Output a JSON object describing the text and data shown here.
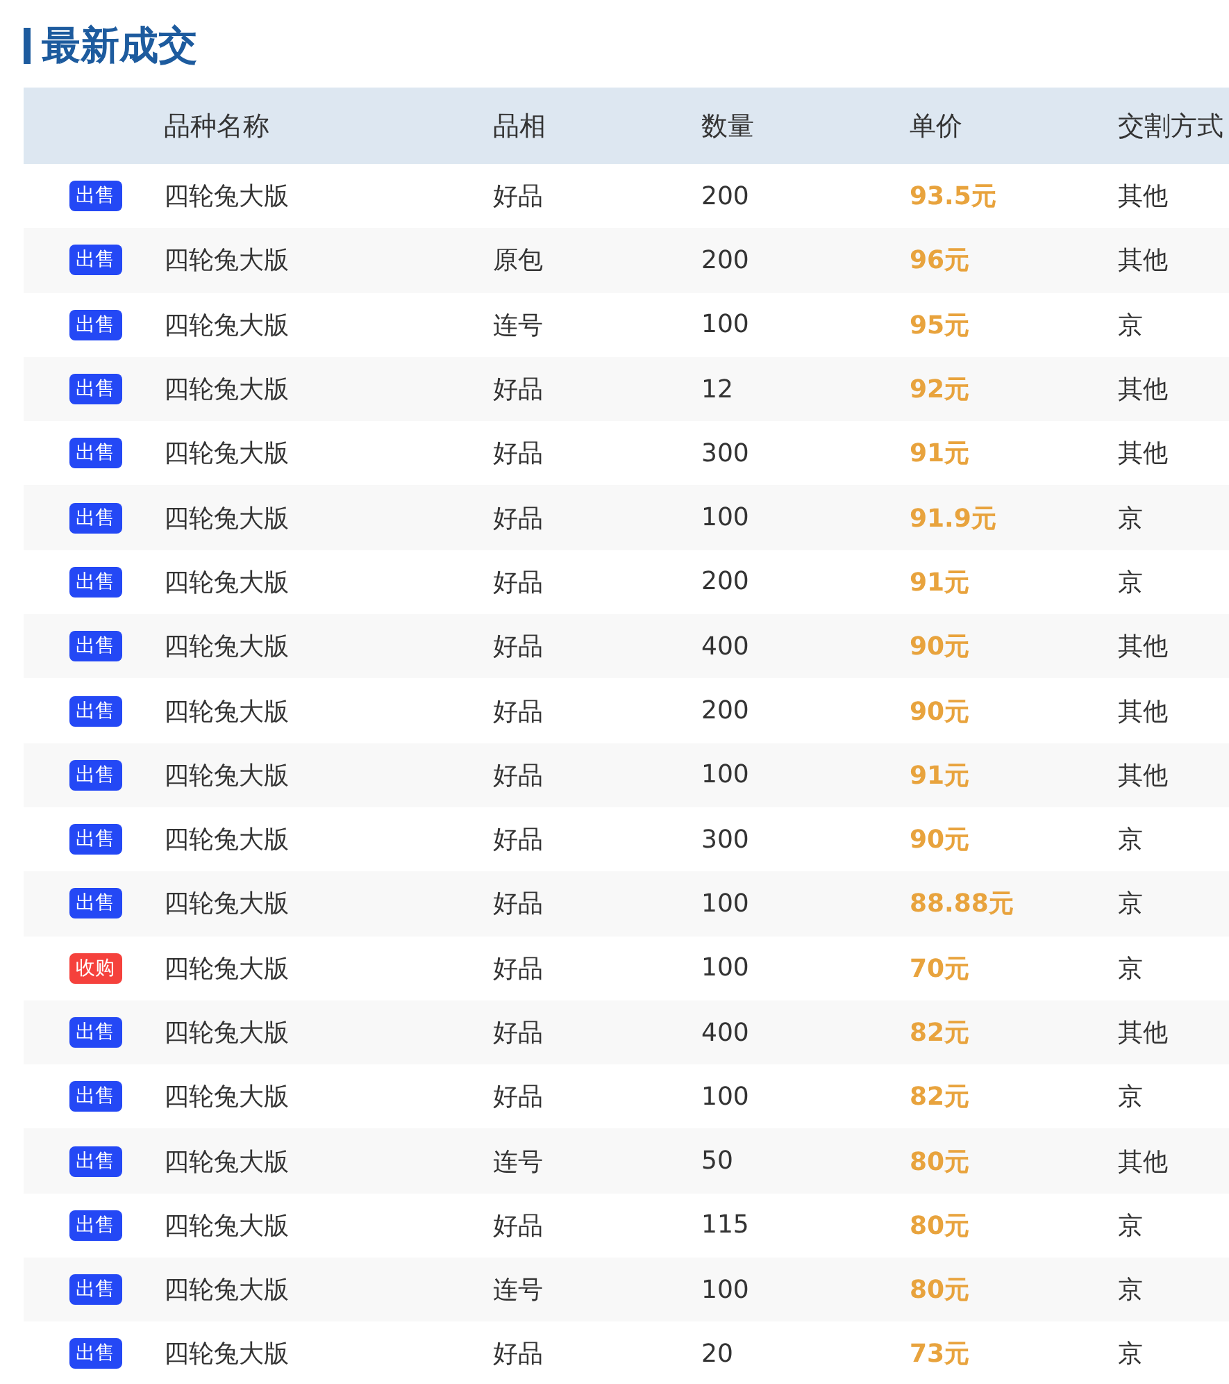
{
  "title": "最新成交",
  "table": {
    "columns": [
      "品种名称",
      "品相",
      "数量",
      "单价",
      "交割方式"
    ],
    "rows": [
      {
        "kind": "sell",
        "tag": "出售",
        "name": "四轮兔大版",
        "grade": "好品",
        "qty": "200",
        "price": "93.5元",
        "delivery": "其他"
      },
      {
        "kind": "sell",
        "tag": "出售",
        "name": "四轮兔大版",
        "grade": "原包",
        "qty": "200",
        "price": "96元",
        "delivery": "其他"
      },
      {
        "kind": "sell",
        "tag": "出售",
        "name": "四轮兔大版",
        "grade": "连号",
        "qty": "100",
        "price": "95元",
        "delivery": "京"
      },
      {
        "kind": "sell",
        "tag": "出售",
        "name": "四轮兔大版",
        "grade": "好品",
        "qty": "12",
        "price": "92元",
        "delivery": "其他"
      },
      {
        "kind": "sell",
        "tag": "出售",
        "name": "四轮兔大版",
        "grade": "好品",
        "qty": "300",
        "price": "91元",
        "delivery": "其他"
      },
      {
        "kind": "sell",
        "tag": "出售",
        "name": "四轮兔大版",
        "grade": "好品",
        "qty": "100",
        "price": "91.9元",
        "delivery": "京"
      },
      {
        "kind": "sell",
        "tag": "出售",
        "name": "四轮兔大版",
        "grade": "好品",
        "qty": "200",
        "price": "91元",
        "delivery": "京"
      },
      {
        "kind": "sell",
        "tag": "出售",
        "name": "四轮兔大版",
        "grade": "好品",
        "qty": "400",
        "price": "90元",
        "delivery": "其他"
      },
      {
        "kind": "sell",
        "tag": "出售",
        "name": "四轮兔大版",
        "grade": "好品",
        "qty": "200",
        "price": "90元",
        "delivery": "其他"
      },
      {
        "kind": "sell",
        "tag": "出售",
        "name": "四轮兔大版",
        "grade": "好品",
        "qty": "100",
        "price": "91元",
        "delivery": "其他"
      },
      {
        "kind": "sell",
        "tag": "出售",
        "name": "四轮兔大版",
        "grade": "好品",
        "qty": "300",
        "price": "90元",
        "delivery": "京"
      },
      {
        "kind": "sell",
        "tag": "出售",
        "name": "四轮兔大版",
        "grade": "好品",
        "qty": "100",
        "price": "88.88元",
        "delivery": "京"
      },
      {
        "kind": "buy",
        "tag": "收购",
        "name": "四轮兔大版",
        "grade": "好品",
        "qty": "100",
        "price": "70元",
        "delivery": "京"
      },
      {
        "kind": "sell",
        "tag": "出售",
        "name": "四轮兔大版",
        "grade": "好品",
        "qty": "400",
        "price": "82元",
        "delivery": "其他"
      },
      {
        "kind": "sell",
        "tag": "出售",
        "name": "四轮兔大版",
        "grade": "好品",
        "qty": "100",
        "price": "82元",
        "delivery": "京"
      },
      {
        "kind": "sell",
        "tag": "出售",
        "name": "四轮兔大版",
        "grade": "连号",
        "qty": "50",
        "price": "80元",
        "delivery": "其他"
      },
      {
        "kind": "sell",
        "tag": "出售",
        "name": "四轮兔大版",
        "grade": "好品",
        "qty": "115",
        "price": "80元",
        "delivery": "京"
      },
      {
        "kind": "sell",
        "tag": "出售",
        "name": "四轮兔大版",
        "grade": "连号",
        "qty": "100",
        "price": "80元",
        "delivery": "京"
      },
      {
        "kind": "sell",
        "tag": "出售",
        "name": "四轮兔大版",
        "grade": "好品",
        "qty": "20",
        "price": "73元",
        "delivery": "京"
      }
    ]
  }
}
